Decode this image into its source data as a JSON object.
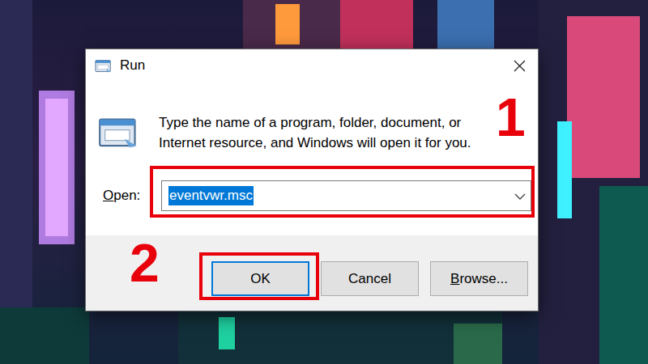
{
  "window": {
    "title": "Run"
  },
  "prompt": [
    "Type the name of a program, folder, document, or",
    "Internet resource, and Windows will open it for you."
  ],
  "open_field": {
    "label": "Open:",
    "access_key": "O",
    "value": "eventvwr.msc",
    "value_selected": true
  },
  "buttons": [
    {
      "label": "OK",
      "access_key": null,
      "default": true
    },
    {
      "label": "Cancel",
      "access_key": null,
      "default": false
    },
    {
      "label": "Browse...",
      "access_key": "B",
      "default": false
    }
  ],
  "annotations": [
    {
      "label": "1"
    },
    {
      "label": "2"
    }
  ]
}
